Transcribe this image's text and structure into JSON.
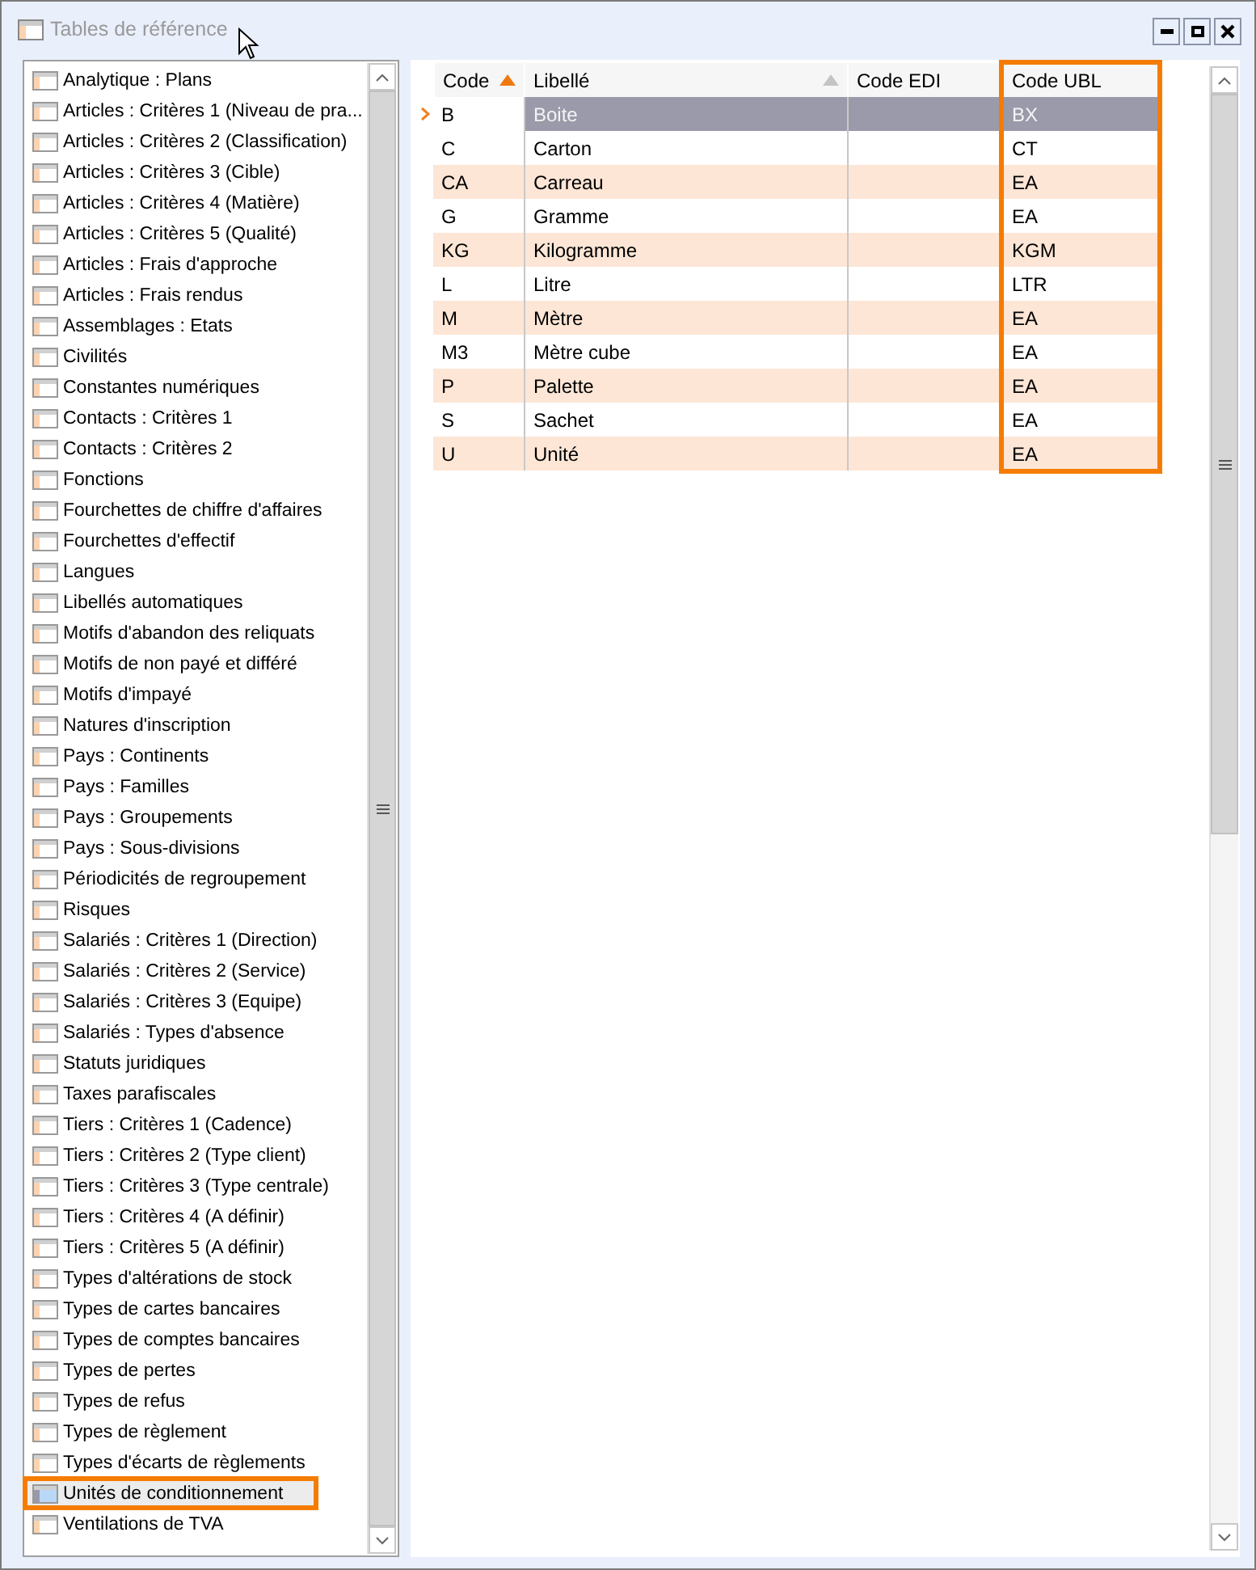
{
  "window": {
    "title": "Tables de référence"
  },
  "sidebar": {
    "items": [
      {
        "label": "Analytique : Plans",
        "selected": false,
        "highlighted": false
      },
      {
        "label": "Articles : Critères 1 (Niveau de pra...",
        "selected": false,
        "highlighted": false
      },
      {
        "label": "Articles : Critères 2 (Classification)",
        "selected": false,
        "highlighted": false
      },
      {
        "label": "Articles : Critères 3 (Cible)",
        "selected": false,
        "highlighted": false
      },
      {
        "label": "Articles : Critères 4 (Matière)",
        "selected": false,
        "highlighted": false
      },
      {
        "label": "Articles : Critères 5 (Qualité)",
        "selected": false,
        "highlighted": false
      },
      {
        "label": "Articles : Frais d'approche",
        "selected": false,
        "highlighted": false
      },
      {
        "label": "Articles : Frais rendus",
        "selected": false,
        "highlighted": false
      },
      {
        "label": "Assemblages : Etats",
        "selected": false,
        "highlighted": false
      },
      {
        "label": "Civilités",
        "selected": false,
        "highlighted": false
      },
      {
        "label": "Constantes numériques",
        "selected": false,
        "highlighted": false
      },
      {
        "label": "Contacts : Critères 1",
        "selected": false,
        "highlighted": false
      },
      {
        "label": "Contacts : Critères 2",
        "selected": false,
        "highlighted": false
      },
      {
        "label": "Fonctions",
        "selected": false,
        "highlighted": false
      },
      {
        "label": "Fourchettes de chiffre d'affaires",
        "selected": false,
        "highlighted": false
      },
      {
        "label": "Fourchettes d'effectif",
        "selected": false,
        "highlighted": false
      },
      {
        "label": "Langues",
        "selected": false,
        "highlighted": false
      },
      {
        "label": "Libellés automatiques",
        "selected": false,
        "highlighted": false
      },
      {
        "label": "Motifs d'abandon des reliquats",
        "selected": false,
        "highlighted": false
      },
      {
        "label": "Motifs de non payé et différé",
        "selected": false,
        "highlighted": false
      },
      {
        "label": "Motifs d'impayé",
        "selected": false,
        "highlighted": false
      },
      {
        "label": "Natures d'inscription",
        "selected": false,
        "highlighted": false
      },
      {
        "label": "Pays : Continents",
        "selected": false,
        "highlighted": false
      },
      {
        "label": "Pays : Familles",
        "selected": false,
        "highlighted": false
      },
      {
        "label": "Pays : Groupements",
        "selected": false,
        "highlighted": false
      },
      {
        "label": "Pays : Sous-divisions",
        "selected": false,
        "highlighted": false
      },
      {
        "label": "Périodicités de regroupement",
        "selected": false,
        "highlighted": false
      },
      {
        "label": "Risques",
        "selected": false,
        "highlighted": false
      },
      {
        "label": "Salariés : Critères 1 (Direction)",
        "selected": false,
        "highlighted": false
      },
      {
        "label": "Salariés : Critères 2 (Service)",
        "selected": false,
        "highlighted": false
      },
      {
        "label": "Salariés : Critères 3 (Equipe)",
        "selected": false,
        "highlighted": false
      },
      {
        "label": "Salariés : Types d'absence",
        "selected": false,
        "highlighted": false
      },
      {
        "label": "Statuts juridiques",
        "selected": false,
        "highlighted": false
      },
      {
        "label": "Taxes parafiscales",
        "selected": false,
        "highlighted": false
      },
      {
        "label": "Tiers : Critères 1 (Cadence)",
        "selected": false,
        "highlighted": false
      },
      {
        "label": "Tiers : Critères 2 (Type client)",
        "selected": false,
        "highlighted": false
      },
      {
        "label": "Tiers : Critères 3 (Type centrale)",
        "selected": false,
        "highlighted": false
      },
      {
        "label": "Tiers : Critères 4 (A définir)",
        "selected": false,
        "highlighted": false
      },
      {
        "label": "Tiers : Critères 5 (A définir)",
        "selected": false,
        "highlighted": false
      },
      {
        "label": "Types d'altérations de stock",
        "selected": false,
        "highlighted": false
      },
      {
        "label": "Types de cartes bancaires",
        "selected": false,
        "highlighted": false
      },
      {
        "label": "Types de comptes bancaires",
        "selected": false,
        "highlighted": false
      },
      {
        "label": "Types de pertes",
        "selected": false,
        "highlighted": false
      },
      {
        "label": "Types de refus",
        "selected": false,
        "highlighted": false
      },
      {
        "label": "Types de règlement",
        "selected": false,
        "highlighted": false
      },
      {
        "label": "Types d'écarts de règlements",
        "selected": false,
        "highlighted": false
      },
      {
        "label": "Unités de conditionnement",
        "selected": true,
        "highlighted": true
      },
      {
        "label": "Ventilations de TVA",
        "selected": false,
        "highlighted": false
      }
    ]
  },
  "table": {
    "columns": [
      {
        "label": "Code",
        "sorted": true
      },
      {
        "label": "Libellé",
        "sorted": false
      },
      {
        "label": "Code EDI"
      },
      {
        "label": "Code UBL",
        "highlighted": true
      }
    ],
    "rows": [
      {
        "cells": [
          "B",
          "Boite",
          "",
          "BX"
        ],
        "selected": true
      },
      {
        "cells": [
          "C",
          "Carton",
          "",
          "CT"
        ],
        "selected": false
      },
      {
        "cells": [
          "CA",
          "Carreau",
          "",
          "EA"
        ],
        "selected": false
      },
      {
        "cells": [
          "G",
          "Gramme",
          "",
          "EA"
        ],
        "selected": false
      },
      {
        "cells": [
          "KG",
          "Kilogramme",
          "",
          "KGM"
        ],
        "selected": false
      },
      {
        "cells": [
          "L",
          "Litre",
          "",
          "LTR"
        ],
        "selected": false
      },
      {
        "cells": [
          "M",
          "Mètre",
          "",
          "EA"
        ],
        "selected": false
      },
      {
        "cells": [
          "M3",
          "Mètre cube",
          "",
          "EA"
        ],
        "selected": false
      },
      {
        "cells": [
          "P",
          "Palette",
          "",
          "EA"
        ],
        "selected": false
      },
      {
        "cells": [
          "S",
          "Sachet",
          "",
          "EA"
        ],
        "selected": false
      },
      {
        "cells": [
          "U",
          "Unité",
          "",
          "EA"
        ],
        "selected": false
      }
    ]
  }
}
